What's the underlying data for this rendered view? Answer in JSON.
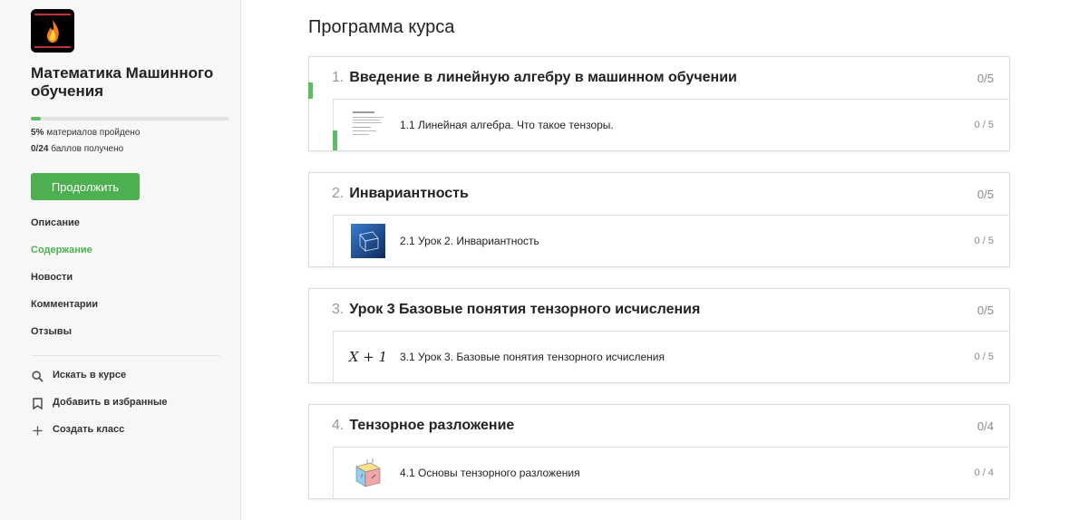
{
  "sidebar": {
    "course_title": "Математика Машинного обучения",
    "progress_percent": 5,
    "stat_materials_value": "5%",
    "stat_materials_label": " материалов пройдено",
    "stat_points_value": "0/24",
    "stat_points_label": " баллов получено",
    "continue_label": "Продолжить",
    "nav": [
      {
        "label": "Описание",
        "active": false
      },
      {
        "label": "Содержание",
        "active": true
      },
      {
        "label": "Новости",
        "active": false
      },
      {
        "label": "Комментарии",
        "active": false
      },
      {
        "label": "Отзывы",
        "active": false
      }
    ],
    "actions": [
      {
        "label": "Искать в курсе",
        "icon": "search-icon"
      },
      {
        "label": "Добавить в избранные",
        "icon": "bookmark-icon"
      },
      {
        "label": "Создать класс",
        "icon": "plus-icon"
      }
    ],
    "accent_color": "#4caf50"
  },
  "main": {
    "title": "Программа курса",
    "modules": [
      {
        "num": "1.",
        "title": "Введение в линейную алгебру в машинном обучении",
        "score": "0/5",
        "lesson": {
          "title": "1.1 Линейная алгебра. Что такое тензоры.",
          "score": "0 / 5",
          "thumb": "document-thumbnail"
        }
      },
      {
        "num": "2.",
        "title": "Инвариантность",
        "score": "0/5",
        "lesson": {
          "title": "2.1 Урок 2. Инвариантность",
          "score": "0 / 5",
          "thumb": "cube-blue-thumbnail"
        }
      },
      {
        "num": "3.",
        "title": "Урок 3 Базовые понятия тензорного исчисления",
        "score": "0/5",
        "lesson": {
          "title": "3.1 Урок 3. Базовые понятия тензорного исчисления",
          "score": "0 / 5",
          "thumb_text": "X + 1"
        }
      },
      {
        "num": "4.",
        "title": "Тензорное разложение",
        "score": "0/4",
        "lesson": {
          "title": "4.1 Основы тензорного разложения",
          "score": "0 / 4",
          "thumb": "tensor-cube-thumbnail"
        }
      }
    ]
  }
}
